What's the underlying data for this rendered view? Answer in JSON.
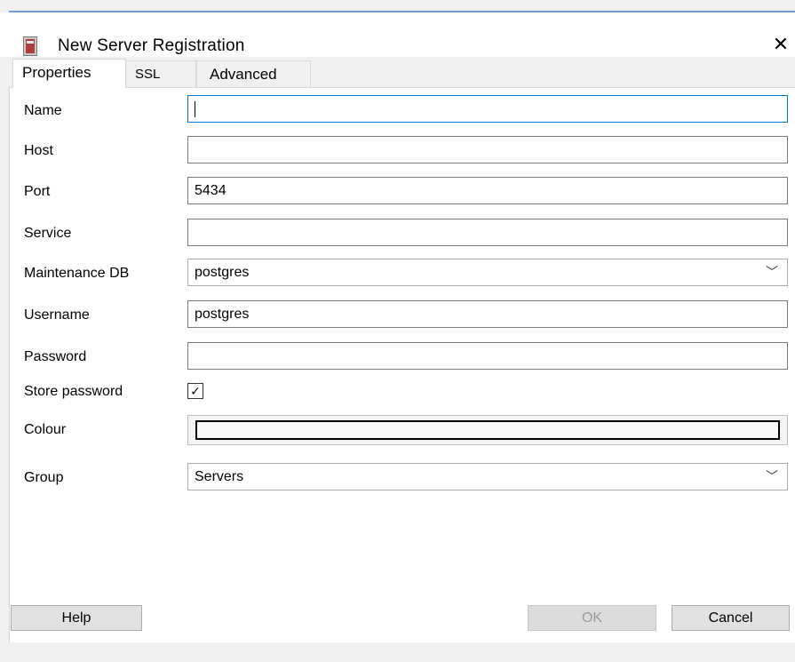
{
  "window": {
    "title": "New Server Registration",
    "close_glyph": "✕",
    "app_icon": "server-icon",
    "close_icon": "close-icon"
  },
  "tabs": [
    {
      "label": "Properties",
      "active": true
    },
    {
      "label": "SSL",
      "active": false
    },
    {
      "label": "Advanced",
      "active": false
    }
  ],
  "form": {
    "name": {
      "label": "Name",
      "value": ""
    },
    "host": {
      "label": "Host",
      "value": ""
    },
    "port": {
      "label": "Port",
      "value": "5434"
    },
    "service": {
      "label": "Service",
      "value": ""
    },
    "maintenance_db": {
      "label": "Maintenance DB",
      "value": "postgres",
      "arrow_glyph": "﹀"
    },
    "username": {
      "label": "Username",
      "value": "postgres"
    },
    "password": {
      "label": "Password",
      "value": ""
    },
    "store_password": {
      "label": "Store password",
      "checked": true,
      "check_glyph": "✓"
    },
    "colour": {
      "label": "Colour"
    },
    "group": {
      "label": "Group",
      "value": "Servers",
      "arrow_glyph": "﹀"
    }
  },
  "buttons": {
    "help": "Help",
    "ok": "OK",
    "cancel": "Cancel"
  },
  "colors": {
    "focus_border": "#0078d7",
    "title_accent_line": "#6f9fd2"
  }
}
